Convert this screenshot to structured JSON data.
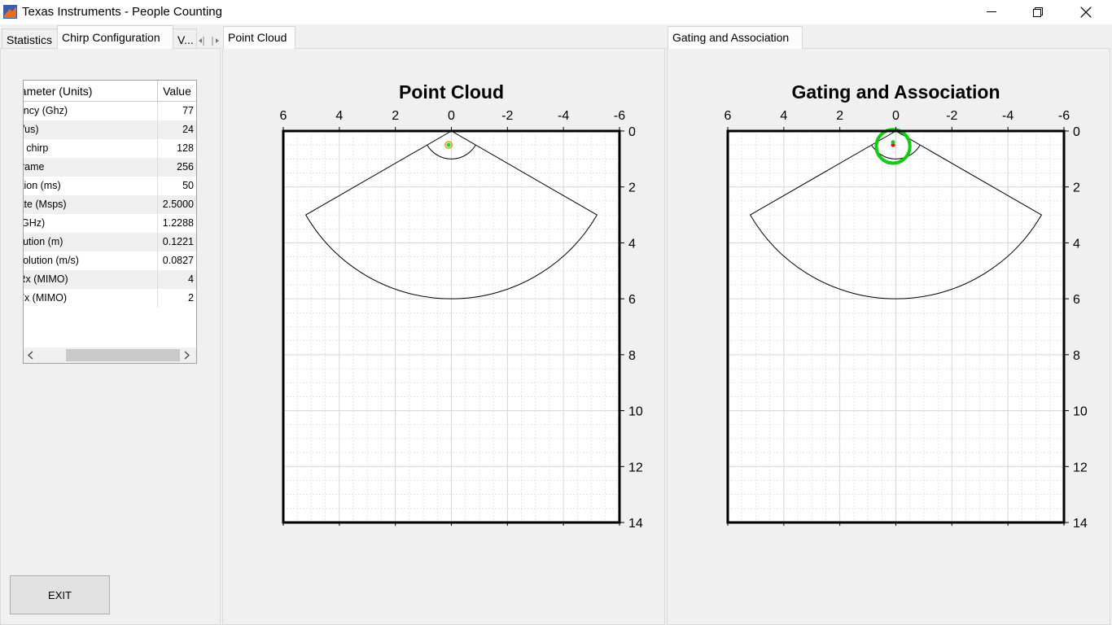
{
  "window": {
    "title": "Texas Instruments - People Counting"
  },
  "left_tabs": {
    "statistics": "Statistics",
    "chirp": "Chirp Configuration",
    "more": "V..."
  },
  "param_table": {
    "headers": [
      "Parameter (Units)",
      "Value"
    ],
    "rows": [
      {
        "label": "equency (Ghz)",
        "value": "77"
      },
      {
        "label": "MHz/us)",
        "value": "24"
      },
      {
        "label": "s per chirp",
        "value": "128"
      },
      {
        "label": "per frame",
        "value": "256"
      },
      {
        "label": "duration (ms)",
        "value": "50"
      },
      {
        "label": "ng rate (Msps)",
        "value": "2.5000"
      },
      {
        "label": "dth (GHz)",
        "value": "1.2288"
      },
      {
        "label": "resolution (m)",
        "value": "0.1221"
      },
      {
        "label": "y resolution (m/s)",
        "value": "0.0827"
      },
      {
        "label": "r of Rx (MIMO)",
        "value": "4"
      },
      {
        "label": "r of Tx (MIMO)",
        "value": "2"
      }
    ]
  },
  "exit_label": "EXIT",
  "point_cloud_tab": "Point Cloud",
  "gating_tab": "Gating and Association",
  "chart_data": [
    {
      "type": "scatter",
      "title": "Point Cloud",
      "xlim": [
        6,
        -6
      ],
      "ylim": [
        0,
        14
      ],
      "x_reversed": true,
      "y_reversed": true,
      "xticks": [
        6,
        4,
        2,
        0,
        -2,
        -4,
        -6
      ],
      "yticks": [
        0,
        2,
        4,
        6,
        8,
        10,
        12,
        14
      ],
      "grid": true,
      "fov_sector": {
        "radius_outer": 6,
        "radius_inner": 1,
        "half_angle_deg": 60
      },
      "points": [
        {
          "x": 0.1,
          "y": 0.5,
          "color": "#2ecc40"
        }
      ],
      "tracks": [
        {
          "x": 0.1,
          "y": 0.5,
          "radius": 0.12,
          "color": "#d4a017"
        }
      ]
    },
    {
      "type": "scatter",
      "title": "Gating and Association",
      "xlim": [
        6,
        -6
      ],
      "ylim": [
        0,
        14
      ],
      "x_reversed": true,
      "y_reversed": true,
      "xticks": [
        6,
        4,
        2,
        0,
        -2,
        -4,
        -6
      ],
      "yticks": [
        0,
        2,
        4,
        6,
        8,
        10,
        12,
        14
      ],
      "grid": true,
      "fov_sector": {
        "radius_outer": 6,
        "radius_inner": 1,
        "half_angle_deg": 60
      },
      "points": [
        {
          "x": 0.1,
          "y": 0.5,
          "color": "#ff0000"
        },
        {
          "x": 0.1,
          "y": 0.4,
          "color": "#22c322"
        }
      ],
      "tracks": [
        {
          "x": 0.1,
          "y": 0.55,
          "radius": 0.6,
          "color": "#11cc11"
        }
      ]
    }
  ]
}
